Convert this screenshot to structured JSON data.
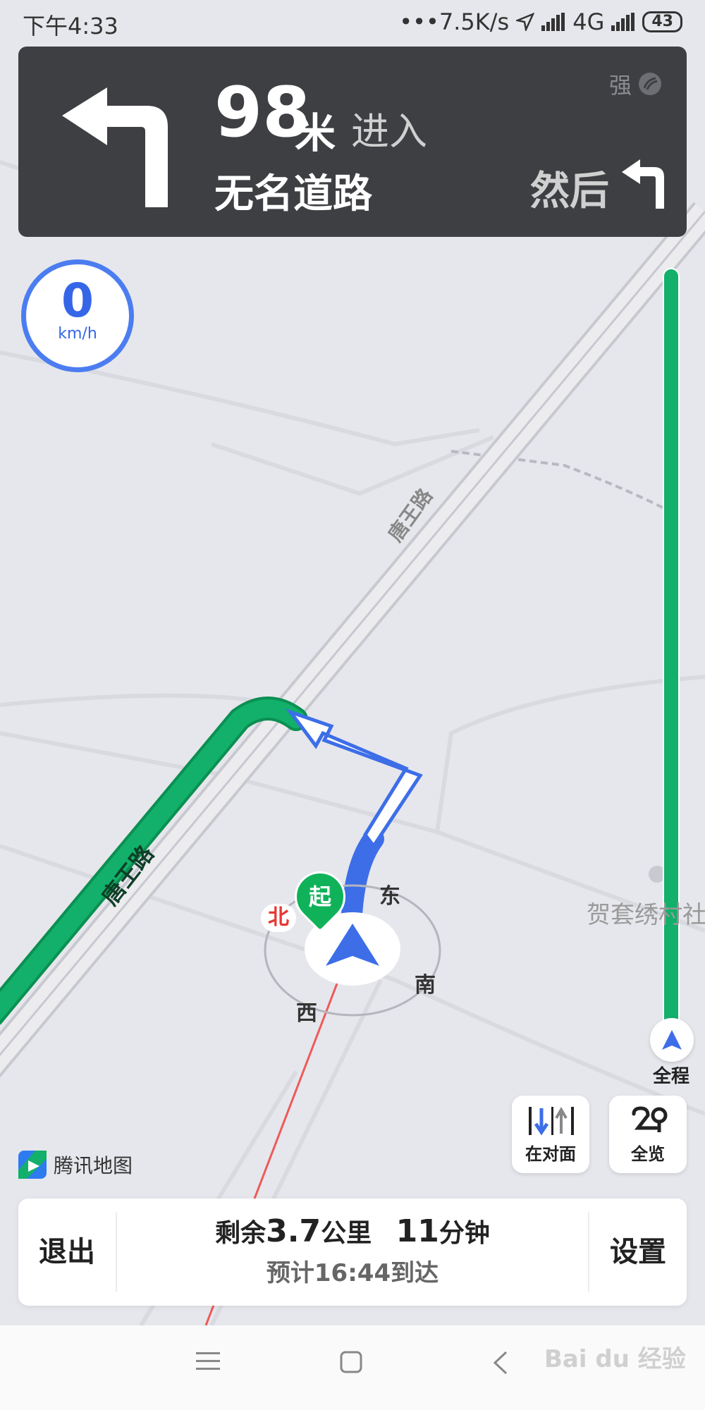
{
  "status_bar": {
    "time": "下午4:33",
    "network_speed": "•••7.5K/s",
    "network_type": "4G",
    "battery": "43"
  },
  "guidance": {
    "distance": "98",
    "unit": "米",
    "action": "进入",
    "road": "无名道路",
    "signal": "强",
    "then_label": "然后",
    "turn_icon": "turn-left-arrow",
    "then_icon": "turn-left-small-arrow"
  },
  "speed": {
    "value": "0",
    "unit": "km/h"
  },
  "map": {
    "road_label_upper": "唐王路",
    "road_label_green": "唐王路",
    "poi_label": "贺套绣村社",
    "start_marker": "起",
    "compass": {
      "north": "北",
      "east": "东",
      "south": "南",
      "west": "西"
    },
    "colors": {
      "route_green": "#12b06a",
      "turn_arrow_blue": "#3d6ee8",
      "compass_north": "#e53935"
    }
  },
  "progress": {
    "label": "全程"
  },
  "buttons": {
    "opposite": "在对面",
    "overview": "全览"
  },
  "logo": {
    "text": "腾讯地图"
  },
  "bottom": {
    "exit": "退出",
    "settings": "设置",
    "remain_prefix": "剩余",
    "remain_distance": "3.7",
    "remain_distance_unit": "公里",
    "remain_time": "11",
    "remain_time_unit": "分钟",
    "eta_prefix": "预计",
    "eta_time": "16:44",
    "eta_suffix": "到达"
  },
  "watermark": "Bai du 经验"
}
